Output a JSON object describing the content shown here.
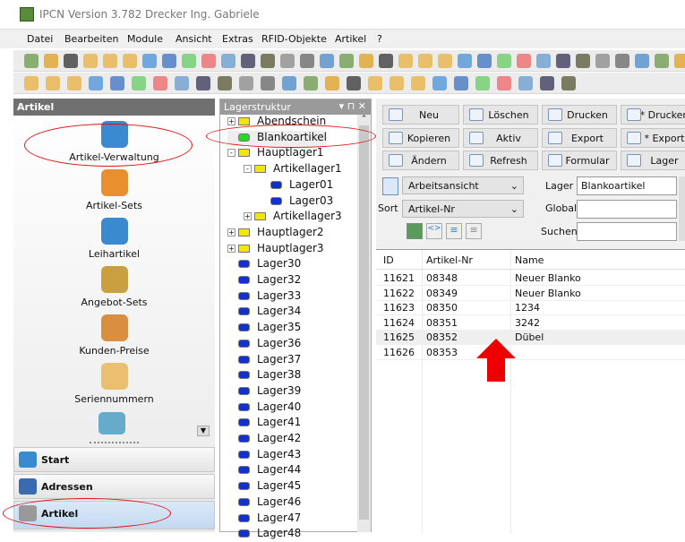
{
  "window": {
    "title": "IPCN Version 3.782  Drecker Ing. Gabriele"
  },
  "menu": [
    "Datei",
    "Bearbeiten",
    "Module",
    "Ansicht",
    "Extras",
    "RFID-Objekte",
    "Artikel",
    "?"
  ],
  "left_panel": {
    "title": "Artikel",
    "items": [
      "Artikel-Verwaltung",
      "Artikel-Sets",
      "Leihartikel",
      "Angebot-Sets",
      "Kunden-Preise",
      "Seriennummern"
    ],
    "nav": [
      "Start",
      "Adressen",
      "Artikel"
    ]
  },
  "tree": {
    "title": "Lagerstruktur",
    "nodes": [
      {
        "label": "Abendschein",
        "level": 0,
        "type": "yellow",
        "expander": "+"
      },
      {
        "label": "Blankoartikel",
        "level": 0,
        "type": "green",
        "expander": ""
      },
      {
        "label": "Hauptlager1",
        "level": 0,
        "type": "yellow",
        "expander": "-"
      },
      {
        "label": "Artikellager1",
        "level": 1,
        "type": "yellow",
        "expander": "-"
      },
      {
        "label": "Lager01",
        "level": 2,
        "type": "blue",
        "expander": ""
      },
      {
        "label": "Lager03",
        "level": 2,
        "type": "blue",
        "expander": ""
      },
      {
        "label": "Artikellager3",
        "level": 1,
        "type": "yellow",
        "expander": "+"
      },
      {
        "label": "Hauptlager2",
        "level": 0,
        "type": "yellow",
        "expander": "+"
      },
      {
        "label": "Hauptlager3",
        "level": 0,
        "type": "yellow",
        "expander": "+"
      },
      {
        "label": "Lager30",
        "level": 0,
        "type": "blue",
        "expander": ""
      },
      {
        "label": "Lager32",
        "level": 0,
        "type": "blue",
        "expander": ""
      },
      {
        "label": "Lager33",
        "level": 0,
        "type": "blue",
        "expander": ""
      },
      {
        "label": "Lager34",
        "level": 0,
        "type": "blue",
        "expander": ""
      },
      {
        "label": "Lager35",
        "level": 0,
        "type": "blue",
        "expander": ""
      },
      {
        "label": "Lager36",
        "level": 0,
        "type": "blue",
        "expander": ""
      },
      {
        "label": "Lager37",
        "level": 0,
        "type": "blue",
        "expander": ""
      },
      {
        "label": "Lager38",
        "level": 0,
        "type": "blue",
        "expander": ""
      },
      {
        "label": "Lager39",
        "level": 0,
        "type": "blue",
        "expander": ""
      },
      {
        "label": "Lager40",
        "level": 0,
        "type": "blue",
        "expander": ""
      },
      {
        "label": "Lager41",
        "level": 0,
        "type": "blue",
        "expander": ""
      },
      {
        "label": "Lager42",
        "level": 0,
        "type": "blue",
        "expander": ""
      },
      {
        "label": "Lager43",
        "level": 0,
        "type": "blue",
        "expander": ""
      },
      {
        "label": "Lager44",
        "level": 0,
        "type": "blue",
        "expander": ""
      },
      {
        "label": "Lager45",
        "level": 0,
        "type": "blue",
        "expander": ""
      },
      {
        "label": "Lager46",
        "level": 0,
        "type": "blue",
        "expander": ""
      },
      {
        "label": "Lager47",
        "level": 0,
        "type": "blue",
        "expander": ""
      },
      {
        "label": "Lager48",
        "level": 0,
        "type": "blue",
        "expander": ""
      }
    ]
  },
  "actions": [
    "Neu",
    "Löschen",
    "Drucken",
    "* Drucken",
    "Kopieren",
    "Aktiv",
    "Export",
    "* Export",
    "Ändern",
    "Refresh",
    "Formular",
    "Lager"
  ],
  "filters": {
    "view": "Arbeitsansicht",
    "sort_label": "Sort",
    "sort": "Artikel-Nr",
    "lager_label": "Lager",
    "lager": "Blankoartikel",
    "global_label": "Global",
    "global": "",
    "suchen_label": "Suchen",
    "suchen": ""
  },
  "table": {
    "columns": [
      "ID",
      "Artikel-Nr",
      "Name"
    ],
    "rows": [
      [
        "11621",
        "08348",
        "Neuer Blanko"
      ],
      [
        "11622",
        "08349",
        "Neuer Blanko"
      ],
      [
        "11623",
        "08350",
        "1234"
      ],
      [
        "11624",
        "08351",
        "3242"
      ],
      [
        "11625",
        "08352",
        "Dübel"
      ],
      [
        "11626",
        "08353",
        ""
      ]
    ],
    "selected_row": 4
  },
  "colors": {
    "annotation": "#e01010",
    "tree_yellow": "#f5e600",
    "tree_green": "#22dd22",
    "tree_blue": "#1030d0"
  }
}
